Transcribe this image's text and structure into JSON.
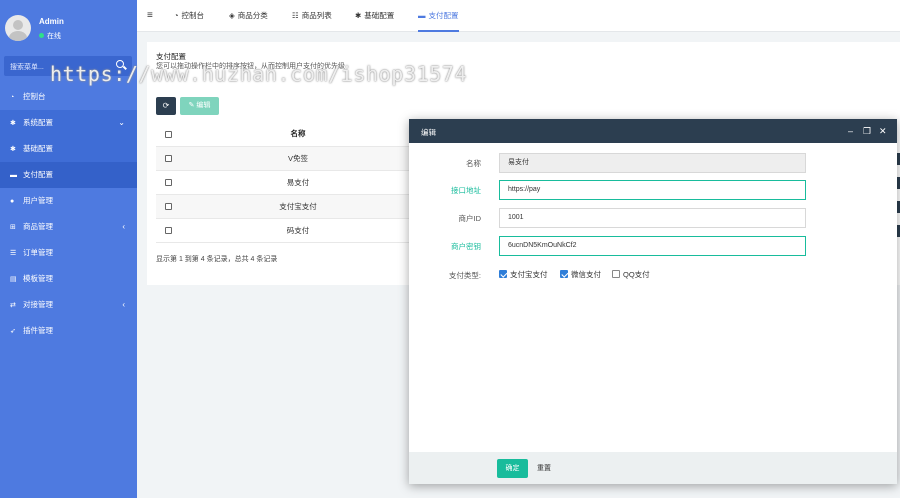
{
  "sidebar": {
    "user": {
      "name": "Admin",
      "status": "在线"
    },
    "search_placeholder": "搜索菜单...",
    "items": [
      {
        "label": "控制台",
        "icon": "dashboard-icon"
      },
      {
        "label": "系统配置",
        "icon": "gear-icon"
      },
      {
        "label": "基础配置",
        "icon": "gear-icon"
      },
      {
        "label": "支付配置",
        "icon": "credit-card-icon"
      },
      {
        "label": "用户管理",
        "icon": "user-icon"
      },
      {
        "label": "商品管理",
        "icon": "cart-icon"
      },
      {
        "label": "订单管理",
        "icon": "list-icon"
      },
      {
        "label": "模板管理",
        "icon": "template-icon"
      },
      {
        "label": "对接管理",
        "icon": "link-icon"
      },
      {
        "label": "插件管理",
        "icon": "rocket-icon"
      }
    ]
  },
  "topbar": {
    "tabs": [
      {
        "label": "控制台"
      },
      {
        "label": "商品分类"
      },
      {
        "label": "商品列表"
      },
      {
        "label": "基础配置"
      },
      {
        "label": "支付配置"
      }
    ]
  },
  "panel": {
    "title": "支付配置",
    "description": "您可以拖动操作栏中的排序按钮，从而控制用户支付的优先级",
    "edit_label": "编辑",
    "table": {
      "header": "名称",
      "rows": [
        "V免签",
        "易支付",
        "支付宝支付",
        "码支付"
      ]
    },
    "pagination_info": "显示第 1 到第 4 条记录，总共 4 条记录"
  },
  "watermark": "https://www.huzhan.com/ishop31574",
  "modal": {
    "title": "编辑",
    "fields": {
      "name": {
        "label": "名称",
        "value": "易支付"
      },
      "api_url": {
        "label": "接口地址",
        "value": "https://pay"
      },
      "merchant_id": {
        "label": "商户ID",
        "value": "1001"
      },
      "merchant_key": {
        "label": "商户密钥",
        "value": "6ucnDN5KmOuNkCf2"
      }
    },
    "pay_types": {
      "label": "支付类型:",
      "options": [
        {
          "label": "支付宝支付",
          "checked": true
        },
        {
          "label": "微信支付",
          "checked": true
        },
        {
          "label": "QQ支付",
          "checked": false
        }
      ]
    },
    "confirm_label": "确定",
    "reset_label": "重置"
  },
  "colors": {
    "sidebar": "#4e7ae0",
    "modal_header": "#2c3e50",
    "accent": "#18bc9c"
  }
}
